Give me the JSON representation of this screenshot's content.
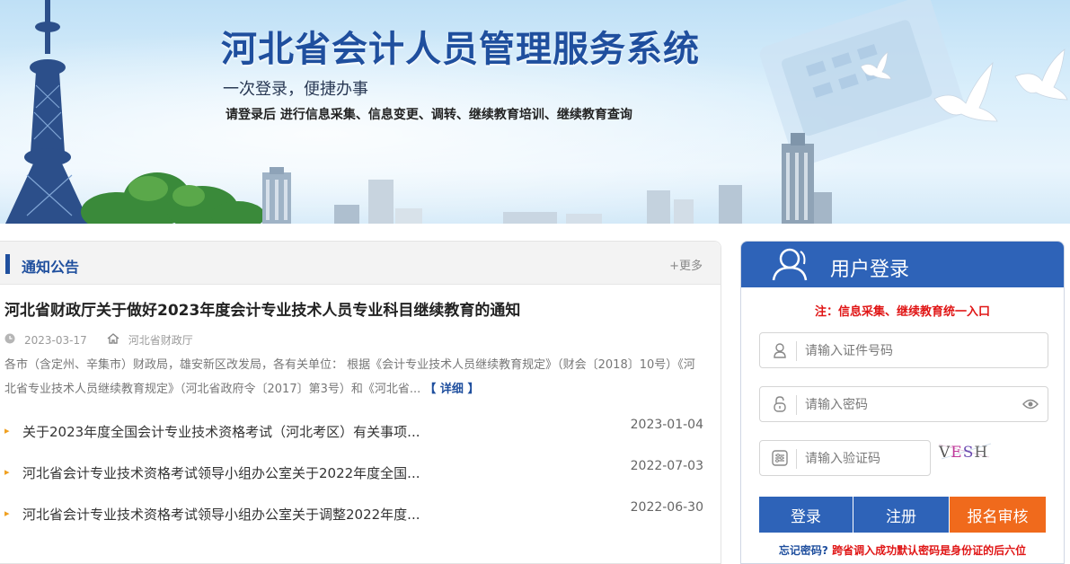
{
  "banner": {
    "title": "河北省会计人员管理服务系统",
    "subtitle": "一次登录，便捷办事",
    "description": "请登录后 进行信息采集、信息变更、调转、继续教育培训、继续教育查询"
  },
  "notice": {
    "title": "通知公告",
    "more_label": "+更多",
    "featured": {
      "title": "河北省财政厅关于做好2023年度会计专业技术人员专业科目继续教育的通知",
      "date": "2023-03-17",
      "source": "河北省财政厅",
      "summary": "各市（含定州、辛集市）财政局，雄安新区改发局，各有关单位：   根据《会计专业技术人员继续教育规定》（财会〔2018〕10号）《河北省专业技术人员继续教育规定》（河北省政府令〔2017〕第3号）和《河北省...",
      "detail_label": "【 详细 】"
    },
    "items": [
      {
        "title": "关于2023年度全国会计专业技术资格考试（河北考区）有关事项...",
        "date": "2023-01-04"
      },
      {
        "title": "河北省会计专业技术资格考试领导小组办公室关于2022年度全国...",
        "date": "2022-07-03"
      },
      {
        "title": "河北省会计专业技术资格考试领导小组办公室关于调整2022年度...",
        "date": "2022-06-30"
      }
    ]
  },
  "login": {
    "title": "用户登录",
    "note": "注：信息采集、继续教育统一入口",
    "id_placeholder": "请输入证件号码",
    "password_placeholder": "请输入密码",
    "captcha_placeholder": "请输入验证码",
    "captcha_text": "VESH",
    "login_label": "登录",
    "register_label": "注册",
    "audit_label": "报名审核",
    "forgot_label": "忘记密码?",
    "forgot_note": "跨省调入成功默认密码是身份证的后六位"
  },
  "colors": {
    "brand_blue": "#2e63b8",
    "title_blue": "#1f4f9e",
    "accent_orange": "#f06a1c",
    "warning_red": "#e01515"
  }
}
